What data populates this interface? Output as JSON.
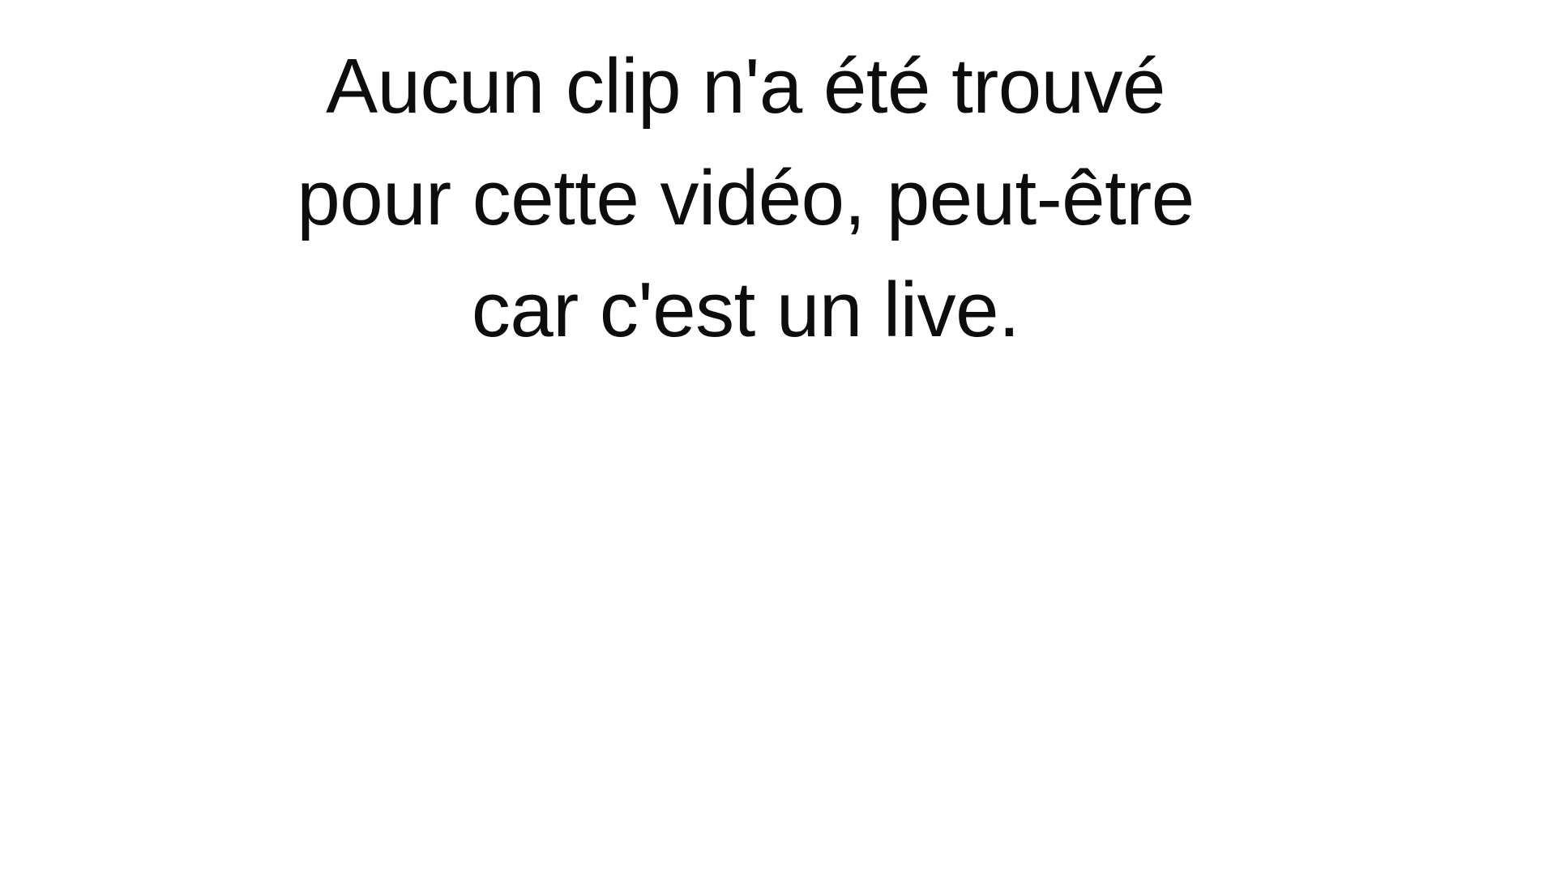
{
  "message": {
    "lines": [
      "Aucun clip n'a été trouvé",
      "pour cette vidéo, peut-être",
      "car c'est un live."
    ]
  },
  "colors": {
    "background": "#ffffff",
    "text": "#0d0d0d"
  }
}
